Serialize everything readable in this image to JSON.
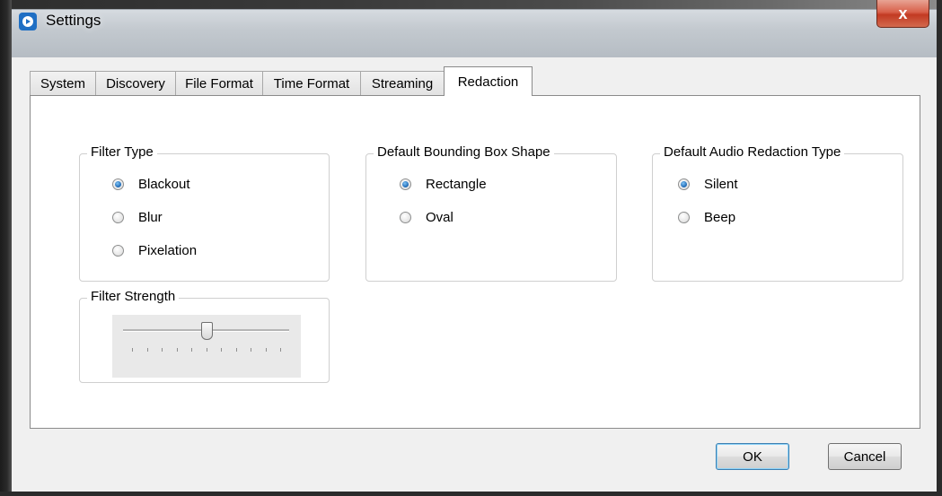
{
  "window": {
    "title": "Settings",
    "close_label": "x"
  },
  "tabs": [
    {
      "label": "System",
      "active": false
    },
    {
      "label": "Discovery",
      "active": false
    },
    {
      "label": "File Format",
      "active": false
    },
    {
      "label": "Time Format",
      "active": false
    },
    {
      "label": "Streaming",
      "active": false
    },
    {
      "label": "Redaction",
      "active": true
    }
  ],
  "filter_type": {
    "title": "Filter Type",
    "options": [
      {
        "label": "Blackout",
        "checked": true
      },
      {
        "label": "Blur",
        "checked": false
      },
      {
        "label": "Pixelation",
        "checked": false
      }
    ]
  },
  "bounding_box": {
    "title": "Default Bounding Box Shape",
    "options": [
      {
        "label": "Rectangle",
        "checked": true
      },
      {
        "label": "Oval",
        "checked": false
      }
    ]
  },
  "audio_redaction": {
    "title": "Default Audio Redaction Type",
    "options": [
      {
        "label": "Silent",
        "checked": true
      },
      {
        "label": "Beep",
        "checked": false
      }
    ]
  },
  "filter_strength": {
    "title": "Filter Strength",
    "value": 0.5,
    "tick_count": 11
  },
  "buttons": {
    "ok": "OK",
    "cancel": "Cancel"
  },
  "colors": {
    "accent": "#1b66b3",
    "close_button": "#c23a22"
  }
}
